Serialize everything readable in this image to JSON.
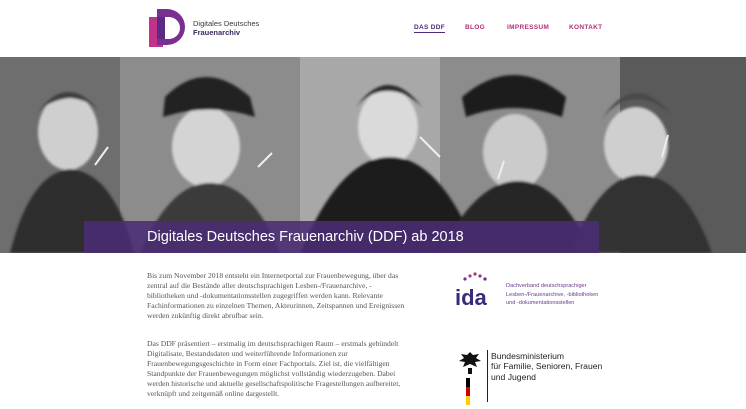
{
  "header": {
    "logo_line1": "Digitales Deutsches",
    "logo_line2": "Frauenarchiv",
    "nav": [
      "DAS DDF",
      "BLOG",
      "IMPRESSUM",
      "KONTAKT"
    ]
  },
  "hero": {
    "title": "Digitales Deutsches Frauenarchiv (DDF) ab 2018"
  },
  "content": {
    "paragraph1": "Bis zum November 2018 entsteht ein Internetportal zur Frauenbewegung, über das zentral auf die Bestände aller deutschsprachigen Lesben-/Frauenarchive, -bibliotheken und -dokumentationsstellen zugegriffen werden kann. Relevante Fachinformationen zu einzelnen Themen, Akteurinnen, Zeitspannen und Ereignissen werden zukünftig direkt abrufbar sein.",
    "paragraph2": "Das DDF präsentiert – erstmalig im deutschsprachigen Raum – erstmals gebündelt Digitalisate, Bestandsdaten und weiterführende Informationen zur Frauenbewegungsgeschichte in Form einer Fachportals. Ziel ist, die vielfältigen Standpunkte der Frauenbewegungen möglichst vollständig wiederzugeben. Dabei werden historische und aktuelle gesellschaftspolitische Fragestellungen aufbereitet, verknüpft und zeitgemäß online dargestellt."
  },
  "sponsors": {
    "ida_name": "ida",
    "ida_lines": [
      "Dachverband deutschsprachiger",
      "Lesben-/Frauenarchive, -bibliotheken",
      "und -dokumentationsstellen"
    ],
    "ministry_lines": [
      "Bundesministerium",
      "für Familie, Senioren, Frauen",
      "und Jugend"
    ]
  },
  "colors": {
    "brand_purple": "#4a2c74",
    "brand_magenta": "#b0307a"
  }
}
